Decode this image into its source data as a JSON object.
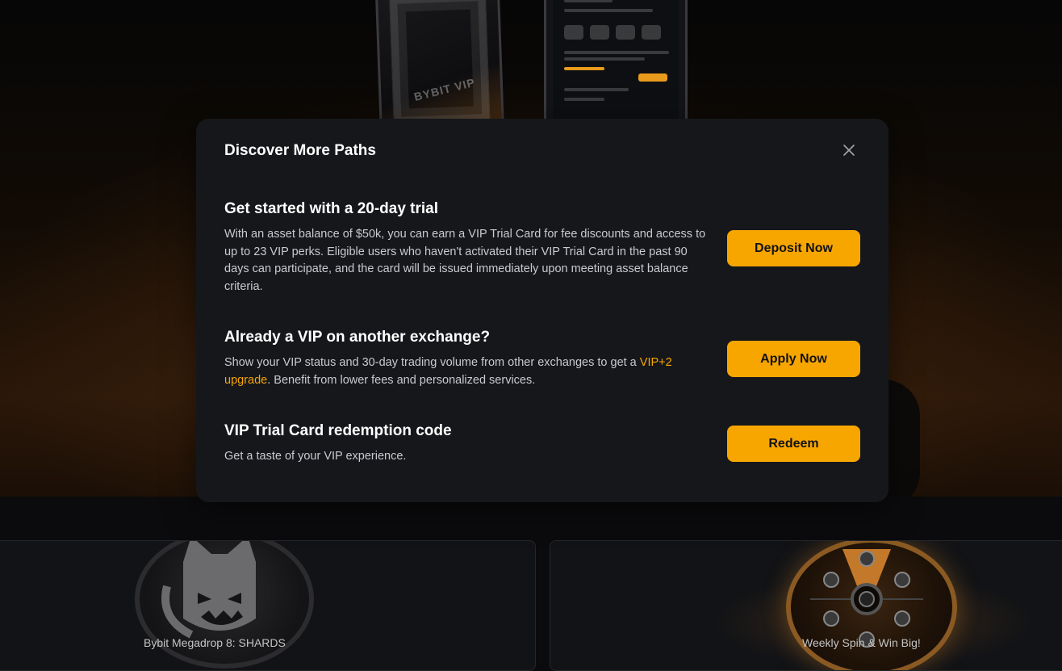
{
  "modal": {
    "title": "Discover More Paths",
    "close_icon": "close-icon",
    "sections": [
      {
        "heading": "Get started with a 20-day trial",
        "description": "With an asset balance of $50k, you can earn a VIP Trial Card for fee discounts and access to up to 23 VIP perks. Eligible users who haven't activated their VIP Trial Card in the past 90 days can participate, and the card will be issued immediately upon meeting asset balance criteria.",
        "button_label": "Deposit Now"
      },
      {
        "heading": "Already a VIP on another exchange?",
        "description_before": "Show your VIP status and 30-day trading volume from other exchanges to get a ",
        "description_link": "VIP+2 upgrade",
        "description_after": ". Benefit from lower fees and personalized services.",
        "button_label": "Apply Now"
      },
      {
        "heading": "VIP Trial Card redemption code",
        "description": "Get a taste of your VIP experience.",
        "button_label": "Redeem"
      }
    ]
  },
  "background": {
    "phone_brand_text": "BYBIT VIP"
  },
  "cards": [
    {
      "title": "Bybit Megadrop 8: SHARDS",
      "icon": "cat-medal-icon"
    },
    {
      "title": "Weekly Spin & Win Big!",
      "icon": "prize-wheel-icon"
    }
  ],
  "colors": {
    "accent": "#f7a600",
    "modal_bg": "#16171b",
    "page_bg": "#0b0b0d"
  }
}
